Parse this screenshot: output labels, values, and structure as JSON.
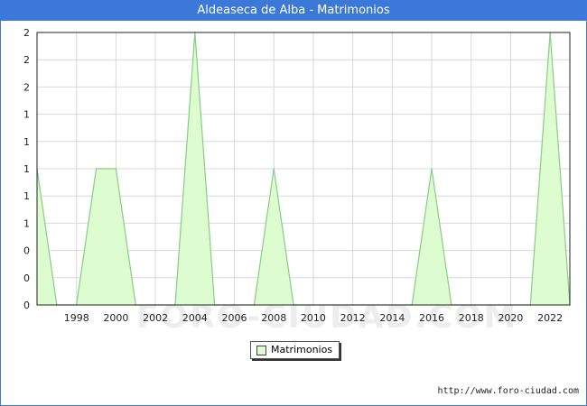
{
  "header": {
    "title": "Aldeaseca de Alba - Matrimonios"
  },
  "legend": {
    "label": "Matrimonios"
  },
  "footer": {
    "source": "http://www.foro-ciudad.com"
  },
  "watermark": {
    "text": "FORO-CIUDAD.COM"
  },
  "colors": {
    "title_bg": "#3c78d8",
    "fill": "#ddfccf",
    "line": "#88cc88",
    "grid": "#d8d8d8"
  },
  "chart_data": {
    "type": "area",
    "title": "Aldeaseca de Alba - Matrimonios",
    "xlabel": "",
    "ylabel": "",
    "x": [
      1996,
      1997,
      1998,
      1999,
      2000,
      2001,
      2002,
      2003,
      2004,
      2005,
      2006,
      2007,
      2008,
      2009,
      2010,
      2011,
      2012,
      2013,
      2014,
      2015,
      2016,
      2017,
      2018,
      2019,
      2020,
      2021,
      2022,
      2023
    ],
    "series": [
      {
        "name": "Matrimonios",
        "values": [
          1,
          0,
          0,
          1,
          1,
          0,
          0,
          0,
          2,
          0,
          0,
          0,
          1,
          0,
          0,
          0,
          0,
          0,
          0,
          0,
          1,
          0,
          0,
          0,
          0,
          0,
          2,
          0
        ]
      }
    ],
    "x_tick_labels": [
      "1998",
      "2000",
      "2002",
      "2004",
      "2006",
      "2008",
      "2010",
      "2012",
      "2014",
      "2016",
      "2018",
      "2020",
      "2022"
    ],
    "y_tick_labels": [
      "0",
      "0",
      "0",
      "1",
      "1",
      "1",
      "1",
      "1",
      "2",
      "2",
      "2"
    ],
    "xlim": [
      1996,
      2023
    ],
    "ylim": [
      0,
      2
    ],
    "grid": true,
    "legend_position": "bottom-center"
  }
}
